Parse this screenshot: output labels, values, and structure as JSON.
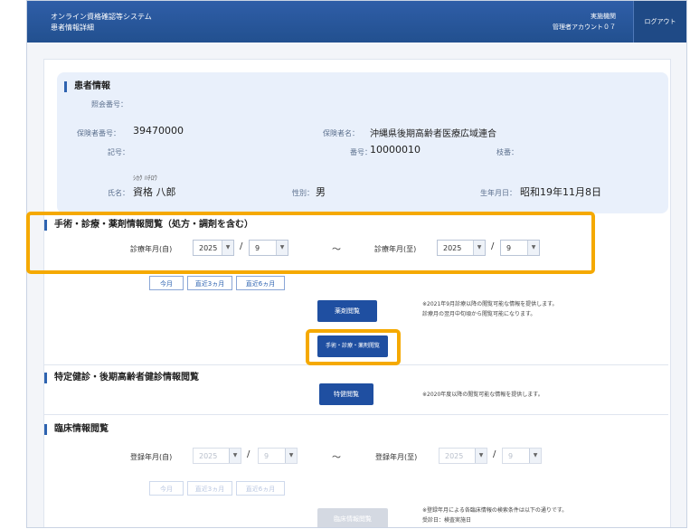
{
  "header": {
    "system_name": "オンライン資格確認等システム",
    "page_title": "患者情報詳細",
    "org_name": "実施機関",
    "account_name": "管理者アカウント０７",
    "logout_label": "ログアウト"
  },
  "patient": {
    "section_title": "患者情報",
    "inquiry_no_label": "照会番号：",
    "inquiry_no_value": "",
    "insurer_no_label": "保険者番号：",
    "insurer_no_value": "39470000",
    "insurer_name_label": "保険者名：",
    "insurer_name_value": "沖縄県後期高齢者医療広域連合",
    "symbol_label": "記号：",
    "symbol_value": "",
    "number_label": "番号：",
    "number_value": "10000010",
    "branch_label": "枝番：",
    "branch_value": "",
    "kana_value": "ｼｶｸ ﾊﾁﾛｳ",
    "name_label": "氏名：",
    "name_value": "資格 八郎",
    "sex_label": "性別：",
    "sex_value": "男",
    "birth_label": "生年月日：",
    "birth_value": "昭和19年11月8日"
  },
  "medical": {
    "section_title": "手術・診療・薬剤情報閲覧（処方・調剤を含む）",
    "from_label": "診療年月(自)",
    "from_year": "2025",
    "from_month": "9",
    "to_label": "診療年月(至)",
    "to_year": "2025",
    "to_month": "9",
    "tilde": "～",
    "slash": "/",
    "btn_this_month": "今月",
    "btn_3months": "直近3ヵ月",
    "btn_6months": "直近6ヵ月",
    "drug_btn_label": "薬剤閲覧",
    "drug_note_1": "※2021年9月診療以降の閲覧可能な情報を提供します。",
    "drug_note_2": "診療月の翌月中旬頃から閲覧可能になります。",
    "surgery_btn_label": "手術・診療・薬剤閲覧"
  },
  "checkup": {
    "section_title": "特定健診・後期高齢者健診情報閲覧",
    "btn_label": "特健閲覧",
    "note": "※2020年度以降の閲覧可能な情報を提供します。"
  },
  "clinical": {
    "section_title": "臨床情報閲覧",
    "from_label": "登録年月(自)",
    "from_year": "2025",
    "from_month": "9",
    "to_label": "登録年月(至)",
    "to_year": "2025",
    "to_month": "9",
    "tilde": "～",
    "slash": "/",
    "btn_this_month": "今月",
    "btn_3months": "直近3ヵ月",
    "btn_6months": "直近6ヵ月",
    "btn_label": "臨床情報閲覧",
    "note_1": "※登録年月による各臨床情報の検索条件は以下の通りです。",
    "note_2": "受診日：検査実施日"
  },
  "icons": {
    "select_arrow": "chevron-down-icon"
  },
  "colors": {
    "header": "#2f5ea8",
    "highlight": "#f5a900",
    "primary_button": "#1f4fa1"
  }
}
